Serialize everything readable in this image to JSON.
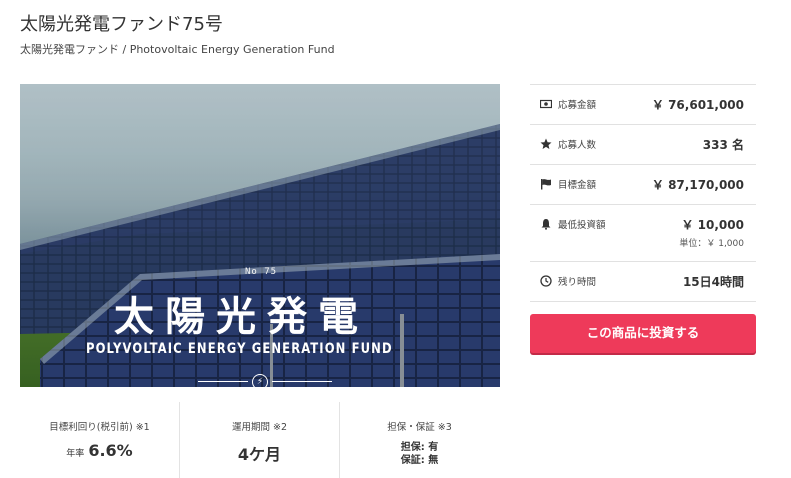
{
  "header": {
    "title": "太陽光発電ファンド75号",
    "subtitle": "太陽光発電ファンド / Photovoltaic Energy Generation Fund"
  },
  "hero": {
    "number": "No 75",
    "title": "太陽光発電",
    "subtitle": "POLYVOLTAIC ENERGY GENERATION FUND"
  },
  "panel": {
    "rows": [
      {
        "icon": "money-icon",
        "label": "応募金額",
        "value": "￥ 76,601,000"
      },
      {
        "icon": "star-icon",
        "label": "応募人数",
        "value": "333 名"
      },
      {
        "icon": "flag-icon",
        "label": "目標金額",
        "value": "￥ 87,170,000"
      },
      {
        "icon": "bell-icon",
        "label": "最低投資額",
        "value": "￥ 10,000",
        "unit": "単位：￥ 1,000"
      },
      {
        "icon": "clock-icon",
        "label": "残り時間",
        "value": "15日4時間"
      }
    ],
    "cta": "この商品に投資する",
    "accent": "#ee3a5a"
  },
  "stats": {
    "yield": {
      "label": "目標利回り(税引前) ※1",
      "prefix": "年率",
      "value": "6.6%"
    },
    "period": {
      "label": "運用期間 ※2",
      "value": "4ケ月"
    },
    "guarantee": {
      "label": "担保・保証 ※3",
      "line1": "担保: 有",
      "line2": "保証: 無"
    }
  }
}
